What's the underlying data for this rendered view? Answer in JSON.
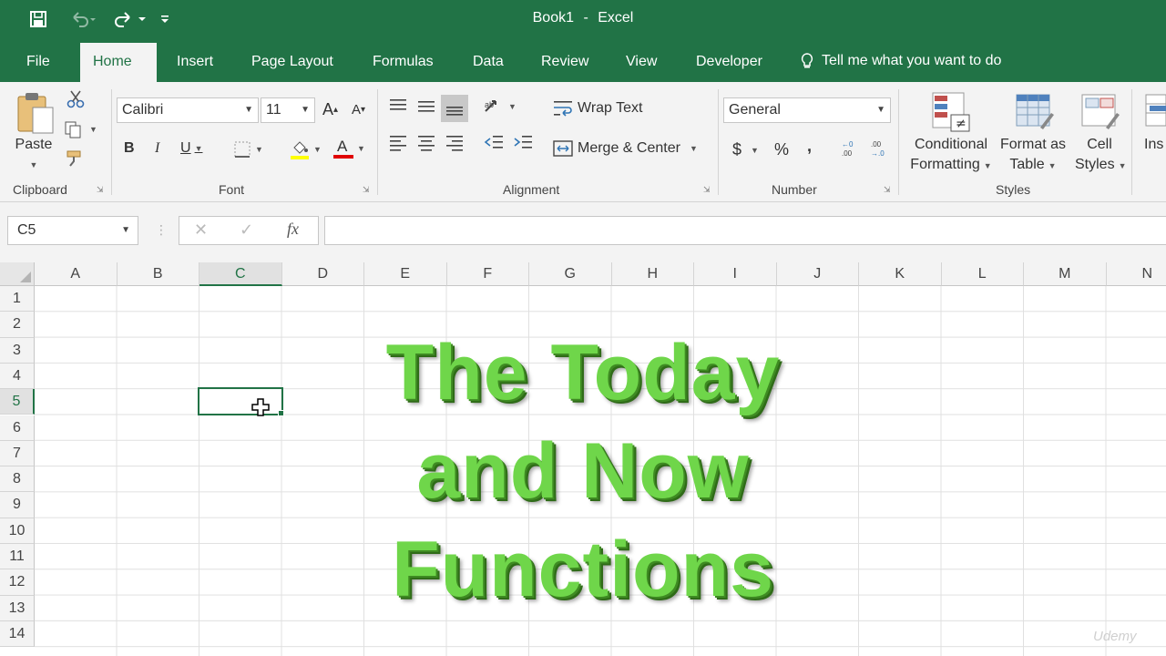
{
  "window": {
    "doc_name": "Book1",
    "separator": "-",
    "app_name": "Excel"
  },
  "tabs": [
    {
      "label": "File"
    },
    {
      "label": "Home",
      "active": true
    },
    {
      "label": "Insert"
    },
    {
      "label": "Page Layout"
    },
    {
      "label": "Formulas"
    },
    {
      "label": "Data"
    },
    {
      "label": "Review"
    },
    {
      "label": "View"
    },
    {
      "label": "Developer"
    }
  ],
  "tell_me": "Tell me what you want to do",
  "ribbon": {
    "clipboard": {
      "paste": "Paste",
      "label": "Clipboard"
    },
    "font": {
      "name": "Calibri",
      "size": "11",
      "bold": "B",
      "italic": "I",
      "underline": "U",
      "label": "Font"
    },
    "alignment": {
      "wrap_text": "Wrap Text",
      "merge_center": "Merge & Center",
      "label": "Alignment"
    },
    "number": {
      "format": "General",
      "currency": "$",
      "percent": "%",
      "comma": ",",
      "label": "Number"
    },
    "styles": {
      "conditional_line1": "Conditional",
      "conditional_line2": "Formatting",
      "format_table_line1": "Format as",
      "format_table_line2": "Table",
      "cell_styles_line1": "Cell",
      "cell_styles_line2": "Styles",
      "label": "Styles"
    },
    "cells": {
      "insert": "Ins"
    }
  },
  "formula_bar": {
    "name_box": "C5",
    "formula": "",
    "fx": "fx"
  },
  "sheet": {
    "columns": [
      "A",
      "B",
      "C",
      "D",
      "E",
      "F",
      "G",
      "H",
      "I",
      "J",
      "K",
      "L",
      "M",
      "N"
    ],
    "rows": [
      "1",
      "2",
      "3",
      "4",
      "5",
      "6",
      "7",
      "8",
      "9",
      "10",
      "11",
      "12",
      "13",
      "14"
    ],
    "selected_column": "C",
    "selected_row": "5"
  },
  "overlay": {
    "line1": "The Today",
    "line2": "and Now",
    "line3": "Functions"
  },
  "watermark": "Udemy",
  "colors": {
    "excel_green": "#217346",
    "overlay_green": "#6fd64a",
    "font_red": "#e00000",
    "highlight_yellow": "#ffff00"
  }
}
